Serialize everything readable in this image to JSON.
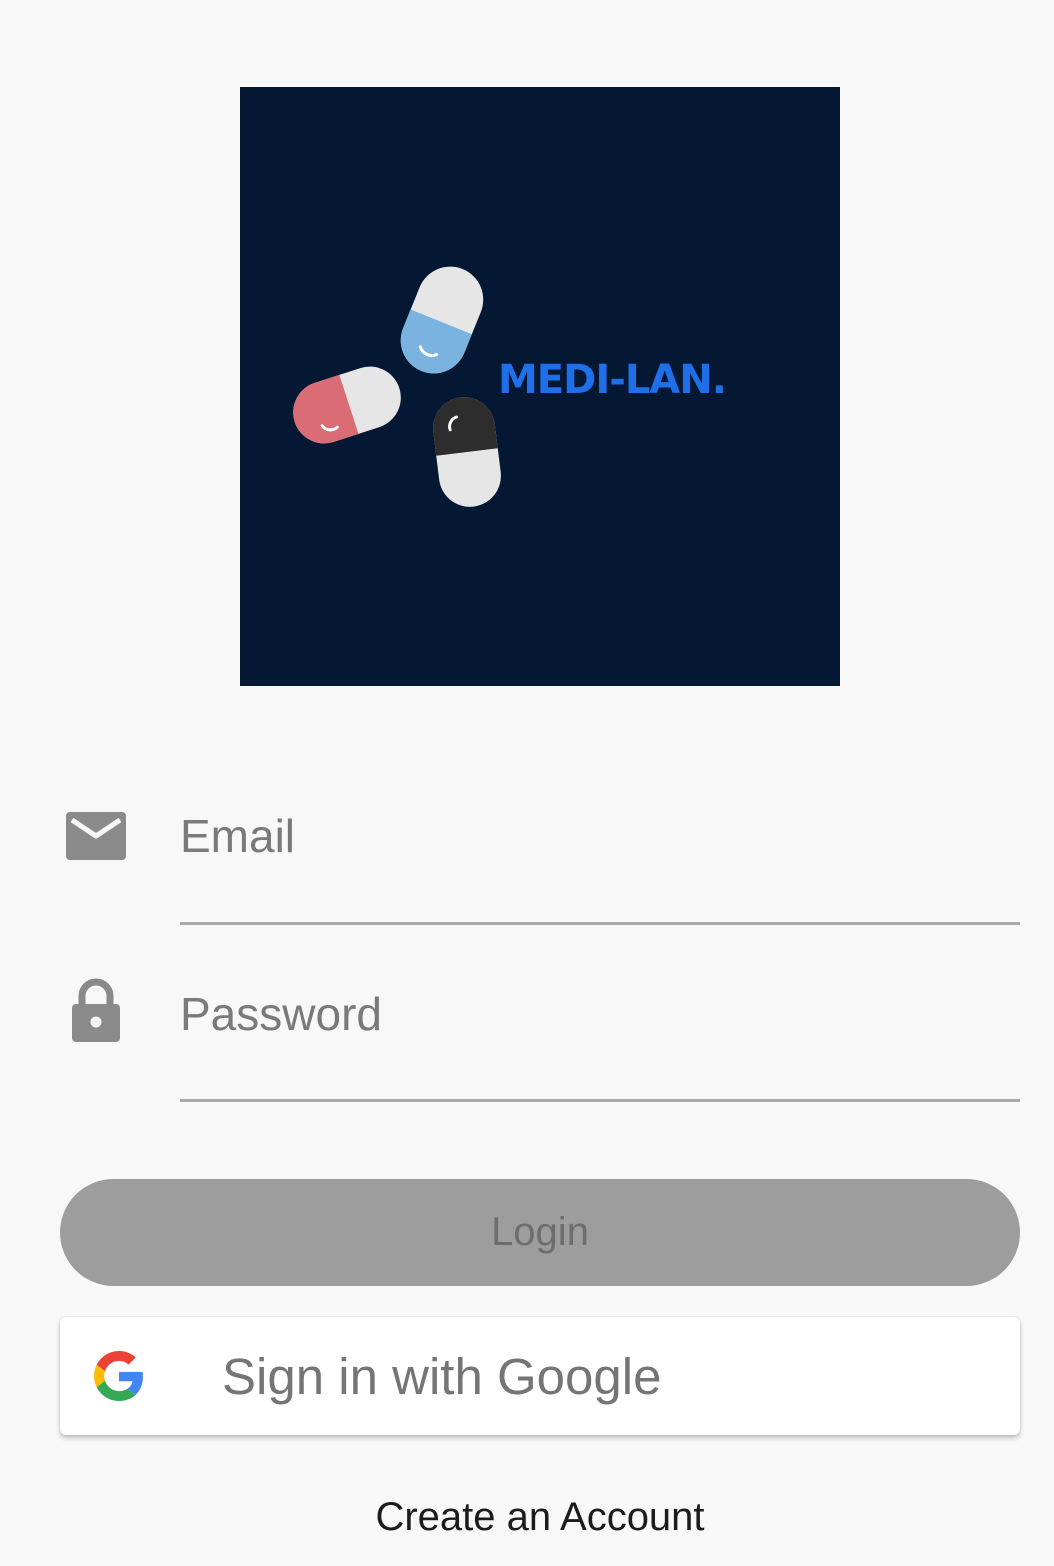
{
  "logo": {
    "brand_text": "MEDI-LAN.",
    "background_color": "#041733",
    "brand_color": "#1f6fe8",
    "pill_colors": [
      "#7ab3e0",
      "#d96c74",
      "#2d2d2d",
      "#e6e6e6"
    ]
  },
  "form": {
    "email": {
      "icon": "mail-icon",
      "placeholder": "Email",
      "value": ""
    },
    "password": {
      "icon": "lock-icon",
      "placeholder": "Password",
      "value": ""
    }
  },
  "buttons": {
    "login_label": "Login",
    "google_label": "Sign in with Google",
    "google_icon": "google-g-icon",
    "create_account_label": "Create an Account"
  },
  "colors": {
    "background": "#f8f8f8",
    "icon_gray": "#8a8a8a",
    "underline": "#a9a9a9",
    "login_disabled_bg": "#9d9d9d",
    "login_disabled_text": "#6e6e6e"
  }
}
